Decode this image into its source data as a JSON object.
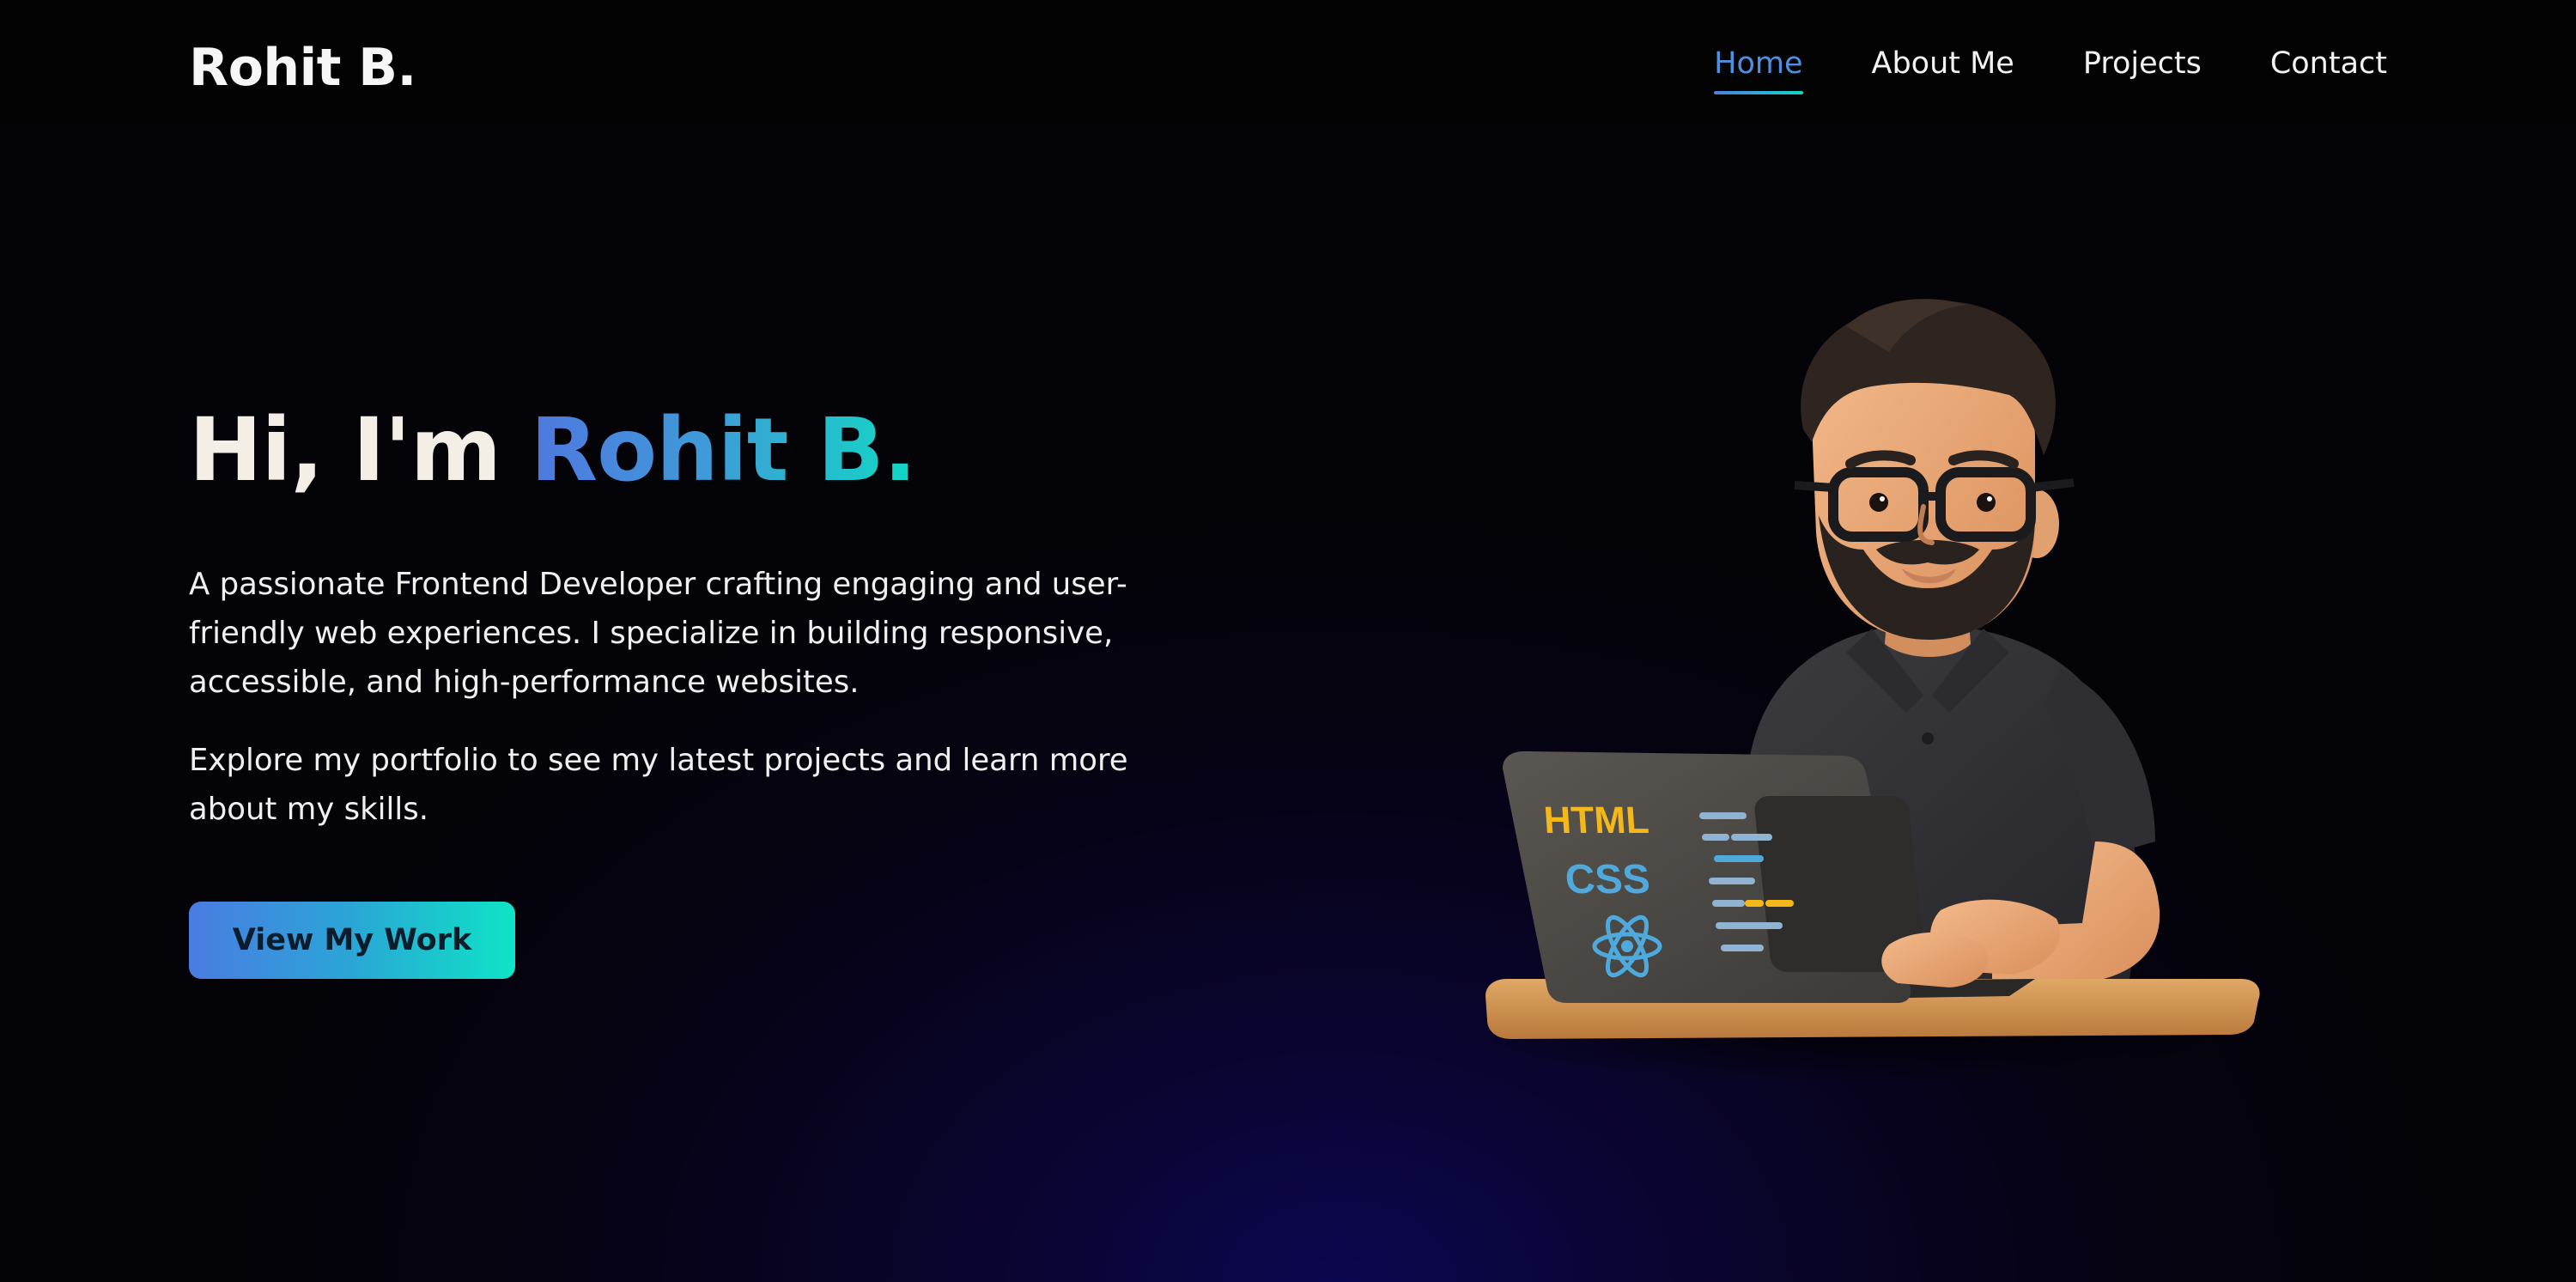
{
  "header": {
    "logo": "Rohit B.",
    "nav": [
      {
        "label": "Home",
        "active": true
      },
      {
        "label": "About Me",
        "active": false
      },
      {
        "label": "Projects",
        "active": false
      },
      {
        "label": "Contact",
        "active": false
      }
    ]
  },
  "hero": {
    "greeting": "Hi, I'm ",
    "name": "Rohit B.",
    "paragraph1": "A passionate Frontend Developer crafting engaging and user-friendly web experiences. I specialize in building responsive, accessible, and high-performance websites.",
    "paragraph2": "Explore my portfolio to see my latest projects and learn more about my skills.",
    "cta_label": "View My Work"
  },
  "illustration": {
    "laptop_text_1": "HTML",
    "laptop_text_2": "CSS",
    "icon": "react-atom-icon"
  },
  "colors": {
    "background": "#040308",
    "accent_start": "#4f78df",
    "accent_end": "#12d8c4",
    "nav_active": "#4f8fe0"
  }
}
